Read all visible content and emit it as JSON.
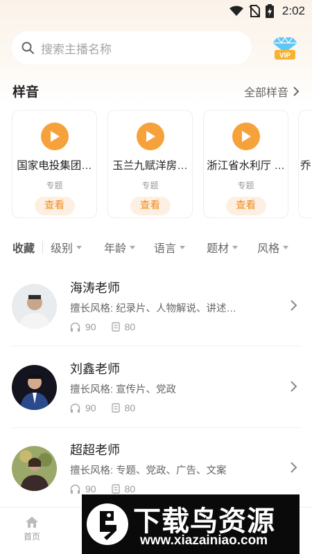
{
  "status_bar": {
    "time": "2:02"
  },
  "search": {
    "placeholder": "搜索主播名称"
  },
  "vip": {
    "label": "VIP"
  },
  "samples": {
    "title": "样音",
    "more_label": "全部样音",
    "cards": [
      {
        "name": "国家电投集团…",
        "tag": "专题",
        "button": "查看"
      },
      {
        "name": "玉兰九赋洋房…",
        "tag": "专题",
        "button": "查看"
      },
      {
        "name": "浙江省水利厅 …",
        "tag": "专题",
        "button": "查看"
      },
      {
        "name": "乔",
        "tag": "",
        "button": ""
      }
    ]
  },
  "filters": {
    "favorites": "收藏",
    "items": [
      "级别",
      "年龄",
      "语言",
      "题材",
      "风格"
    ]
  },
  "anchors": [
    {
      "name": "海涛老师",
      "style_label": "擅长风格:",
      "style_value": "纪录片、人物解说、讲述…",
      "listens": "90",
      "works": "80"
    },
    {
      "name": "刘鑫老师",
      "style_label": "擅长风格:",
      "style_value": "宣传片、党政",
      "listens": "90",
      "works": "80"
    },
    {
      "name": "超超老师",
      "style_label": "擅长风格:",
      "style_value": "专题、党政、广告、文案",
      "listens": "90",
      "works": "80"
    }
  ],
  "bottom_nav": {
    "home": "首页"
  },
  "watermark": {
    "title": "下载鸟资源",
    "url": "www.xiazainiao.com"
  },
  "colors": {
    "accent": "#f6a13a",
    "accent_text": "#f08a1c",
    "accent_bg": "#fdf0e2"
  }
}
